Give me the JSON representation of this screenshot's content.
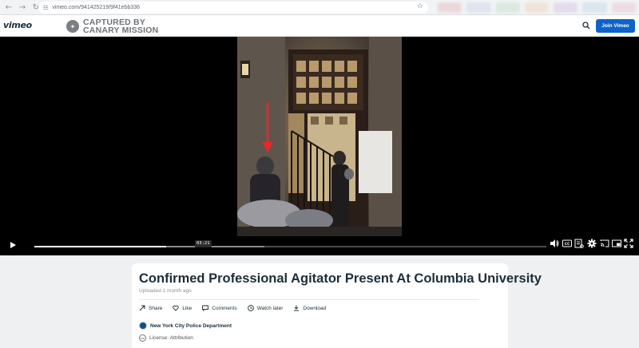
{
  "browser": {
    "url": "vimeo.com/941425219/9f41ebb336",
    "back_icon": "arrow-left-icon",
    "forward_icon": "arrow-right-icon",
    "reload_icon": "reload-icon",
    "bookmark_icon": "star-icon"
  },
  "header": {
    "logo": "vimeo",
    "watermark_line1": "CAPTURED BY",
    "watermark_line2": "CANARY MISSION",
    "join_label": "Join Vimeo",
    "search_icon": "search-icon"
  },
  "player": {
    "current_time": "03:21",
    "progress": 0.257,
    "buffered": 0.45,
    "controls": [
      "play-icon",
      "volume-icon",
      "cc-icon",
      "transcript-icon",
      "settings-icon",
      "cast-icon",
      "pip-icon",
      "fullscreen-icon"
    ]
  },
  "video": {
    "title": "Confirmed Professional Agitator Present At Columbia University",
    "uploaded": "Uploaded 1 month ago",
    "actions": [
      {
        "label": "Share",
        "icon": "share-icon"
      },
      {
        "label": "Like",
        "icon": "heart-icon"
      },
      {
        "label": "Comments",
        "icon": "comment-icon"
      },
      {
        "label": "Watch later",
        "icon": "clock-icon"
      },
      {
        "label": "Download",
        "icon": "download-icon"
      }
    ],
    "owner": "New York City Police Department",
    "license": "License: Attribution"
  },
  "colors": {
    "brand_blue": "#0d63c8",
    "text_dark": "#1a2e3b",
    "annotation_red": "#e02b2b"
  }
}
